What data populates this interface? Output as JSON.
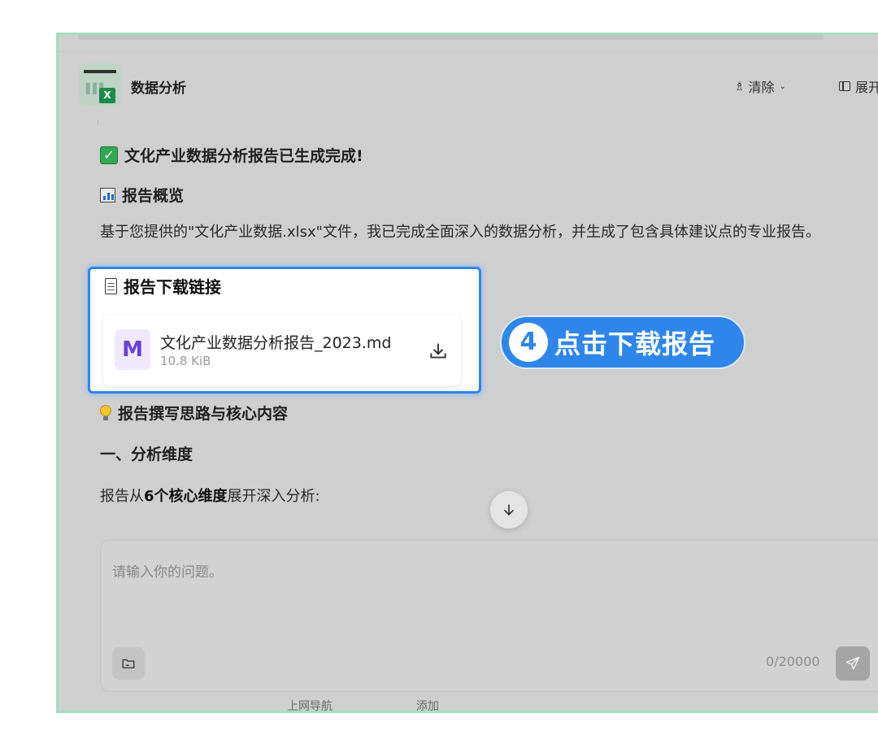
{
  "header": {
    "app_title": "数据分析",
    "clear_label": "清除",
    "expand_label": "展开"
  },
  "message": {
    "done_heading": "文化产业数据分析报告已生成完成!",
    "overview_heading": "报告概览",
    "overview_text": "基于您提供的\"文化产业数据.xlsx\"文件，我已完成全面深入的数据分析，并生成了包含具体建议点的专业报告。",
    "download_heading": "报告下载链接",
    "file": {
      "badge": "M",
      "name": "文化产业数据分析报告_2023.md",
      "size": "10.8 KiB"
    },
    "ideas_heading": "报告撰写思路与核心内容",
    "dimension_heading": "一、分析维度",
    "dimension_text_before": "报告从",
    "dimension_text_bold": "6个核心维度",
    "dimension_text_after": "展开深入分析:"
  },
  "callout": {
    "step": "4",
    "text": "点击下载报告"
  },
  "input": {
    "placeholder": "请输入你的问题。",
    "counter": "0/20000"
  },
  "footer_cut": {
    "left": "上网导航",
    "right": "添加"
  },
  "colors": {
    "accent": "#2f86ea",
    "frame_border": "#a6dcc0",
    "check_green": "#33a852"
  }
}
